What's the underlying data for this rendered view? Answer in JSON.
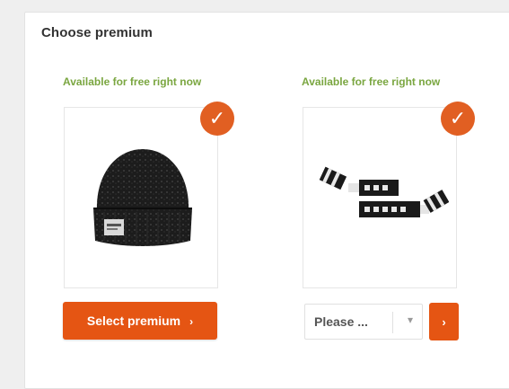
{
  "section": {
    "title": "Choose premium"
  },
  "premiums": [
    {
      "availability": "Available for free right now",
      "check_icon": "checkmark-icon",
      "product_icon": "beanie-hat-icon"
    },
    {
      "availability": "Available for free right now",
      "check_icon": "checkmark-icon",
      "product_icon": "scarf-icon"
    }
  ],
  "actions": {
    "select_label": "Select premium",
    "select_arrow": "›",
    "dropdown_value": "Please ...",
    "dropdown_caret": "▾",
    "go_arrow": "›"
  },
  "colors": {
    "accent": "#e55513",
    "check_badge": "#e15f22",
    "availability_text": "#7aa640"
  }
}
